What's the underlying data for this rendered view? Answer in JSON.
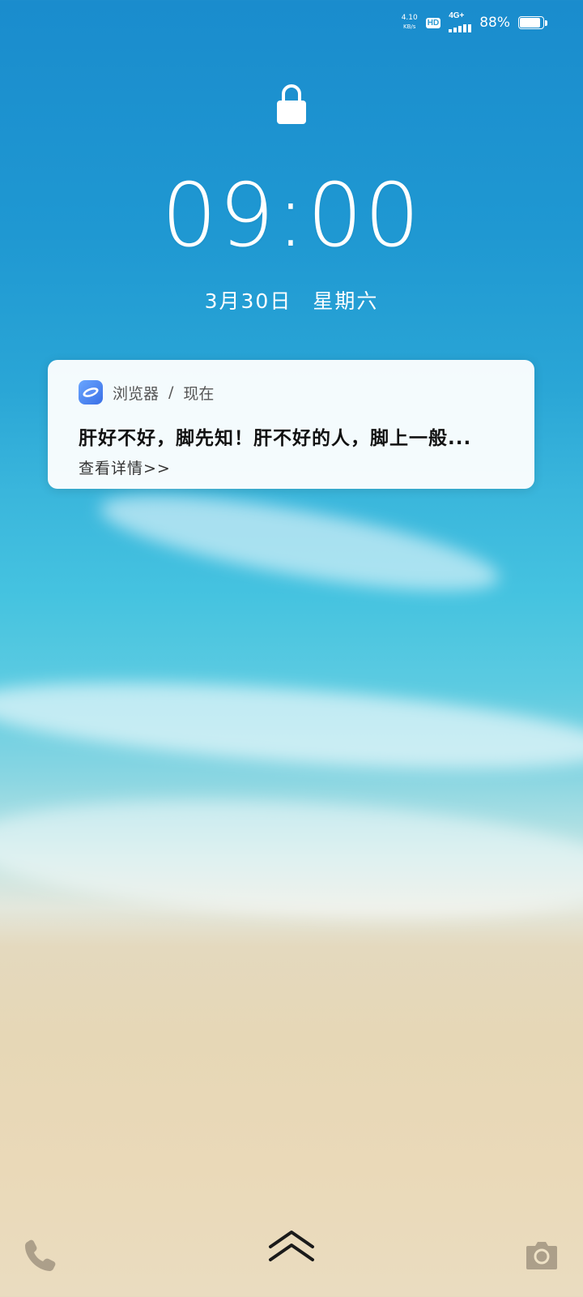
{
  "status_bar": {
    "net_speed_value": "4.10",
    "net_speed_unit": "KB/s",
    "hd_badge": "HD",
    "network_type": "4G+",
    "signal_level": "4 of 5",
    "battery_percent": "88%",
    "battery_level": 0.88
  },
  "lock_screen": {
    "lock_icon": "lock-icon",
    "time": "09:00",
    "date": "3月30日",
    "weekday": "星期六"
  },
  "notification": {
    "app_name": "浏览器",
    "separator": "/",
    "time_label": "现在",
    "title": "肝好不好，脚先知！肝不好的人，脚上一般...",
    "detail_link": "查看详情>>"
  },
  "bottom_bar": {
    "left_icon": "phone-icon",
    "center_icon": "chevron-up-icon",
    "right_icon": "camera-icon"
  },
  "colors": {
    "sea_top": "#1a8ccd",
    "sea_mid": "#45c3e0",
    "sand": "#e6d7b6",
    "notification_bg": "#ffffff",
    "app_icon": "#3a6fe6"
  }
}
